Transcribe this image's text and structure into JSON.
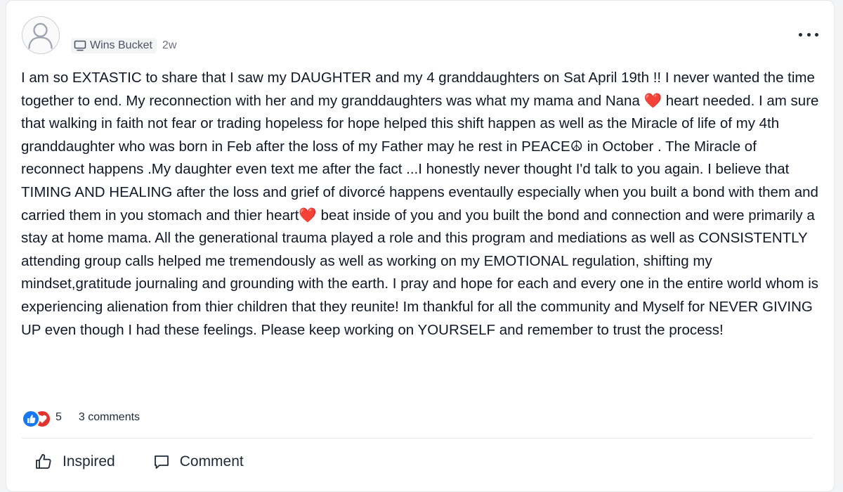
{
  "post": {
    "space": "Wins Bucket",
    "time": "2w",
    "body": "I am so EXTASTIC to share that I saw my DAUGHTER and my 4 granddaughters on Sat April 19th !! I never wanted the time together to end. My reconnection with her and my granddaughters was what my mama and Nana ❤️ heart needed. I am sure that walking in faith not fear or trading hopeless for hope helped this shift happen as well as the Miracle of life of my 4th granddaughter who was born in Feb after the loss of my Father may he rest in PEACE☮ in October . The Miracle of reconnect happens .My daughter even text me after the fact ...I honestly never thought I'd talk to you again. I believe that TIMING AND HEALING after the loss and grief of divorcé happens eventaully especially when you built a bond with them and carried them in you stomach and thier heart❤️ beat inside of you and you built the bond and connection and were primarily a stay at home mama. All the generational trauma played a role and this program and mediations as well as CONSISTENTLY attending group calls helped me tremendously as well as working on my EMOTIONAL regulation, shifting my mindset,gratitude journaling and grounding with the earth. I pray and hope for each and every one in the entire world whom is experiencing alienation from thier children that they reunite! Im thankful for all the community and Myself for NEVER GIVING UP even though I had these feelings. Please keep working on YOURSELF and remember to trust the process!",
    "reaction_count": "5",
    "comments": "3 comments"
  },
  "actions": {
    "inspired": "Inspired",
    "comment": "Comment"
  },
  "icons": {
    "avatar": "user-icon",
    "space": "monitor-icon",
    "more": "more-dots-icon",
    "like_reaction": "thumbs-up-icon",
    "love_reaction": "heart-icon",
    "inspired": "thumbs-up-icon",
    "comment": "speech-bubble-icon"
  },
  "colors": {
    "like": "#1877f2",
    "love": "#e0352f",
    "text": "#111827",
    "muted": "#6b7280"
  }
}
